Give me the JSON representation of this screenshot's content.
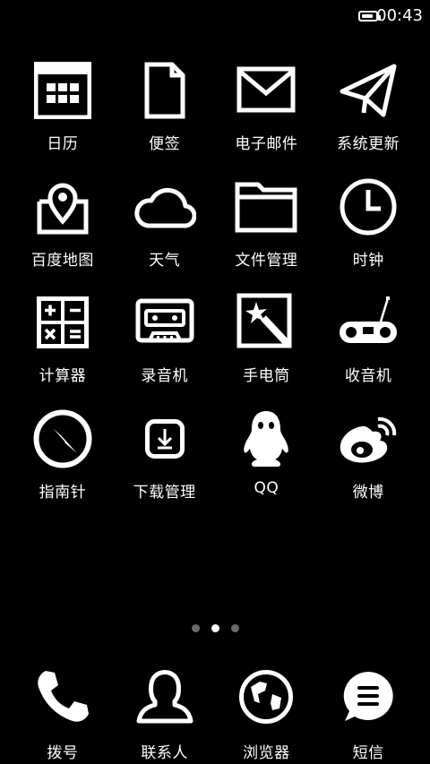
{
  "status": {
    "time": "00:43",
    "battery_level": 0.85
  },
  "apps": [
    {
      "label": "日历",
      "icon": "calendar-icon"
    },
    {
      "label": "便签",
      "icon": "note-icon"
    },
    {
      "label": "电子邮件",
      "icon": "mail-icon"
    },
    {
      "label": "系统更新",
      "icon": "paper-plane-icon"
    },
    {
      "label": "百度地图",
      "icon": "map-icon"
    },
    {
      "label": "天气",
      "icon": "cloud-icon"
    },
    {
      "label": "文件管理",
      "icon": "folder-icon"
    },
    {
      "label": "时钟",
      "icon": "clock-icon"
    },
    {
      "label": "计算器",
      "icon": "calculator-icon"
    },
    {
      "label": "录音机",
      "icon": "cassette-icon"
    },
    {
      "label": "手电筒",
      "icon": "flashlight-icon"
    },
    {
      "label": "收音机",
      "icon": "radio-icon"
    },
    {
      "label": "指南针",
      "icon": "compass-icon"
    },
    {
      "label": "下载管理",
      "icon": "download-icon"
    },
    {
      "label": "QQ",
      "icon": "qq-icon"
    },
    {
      "label": "微博",
      "icon": "weibo-icon"
    }
  ],
  "pager": {
    "count": 3,
    "active": 2
  },
  "dock": [
    {
      "label": "拨号",
      "icon": "phone-icon"
    },
    {
      "label": "联系人",
      "icon": "contacts-icon"
    },
    {
      "label": "浏览器",
      "icon": "globe-icon"
    },
    {
      "label": "短信",
      "icon": "message-icon"
    }
  ]
}
